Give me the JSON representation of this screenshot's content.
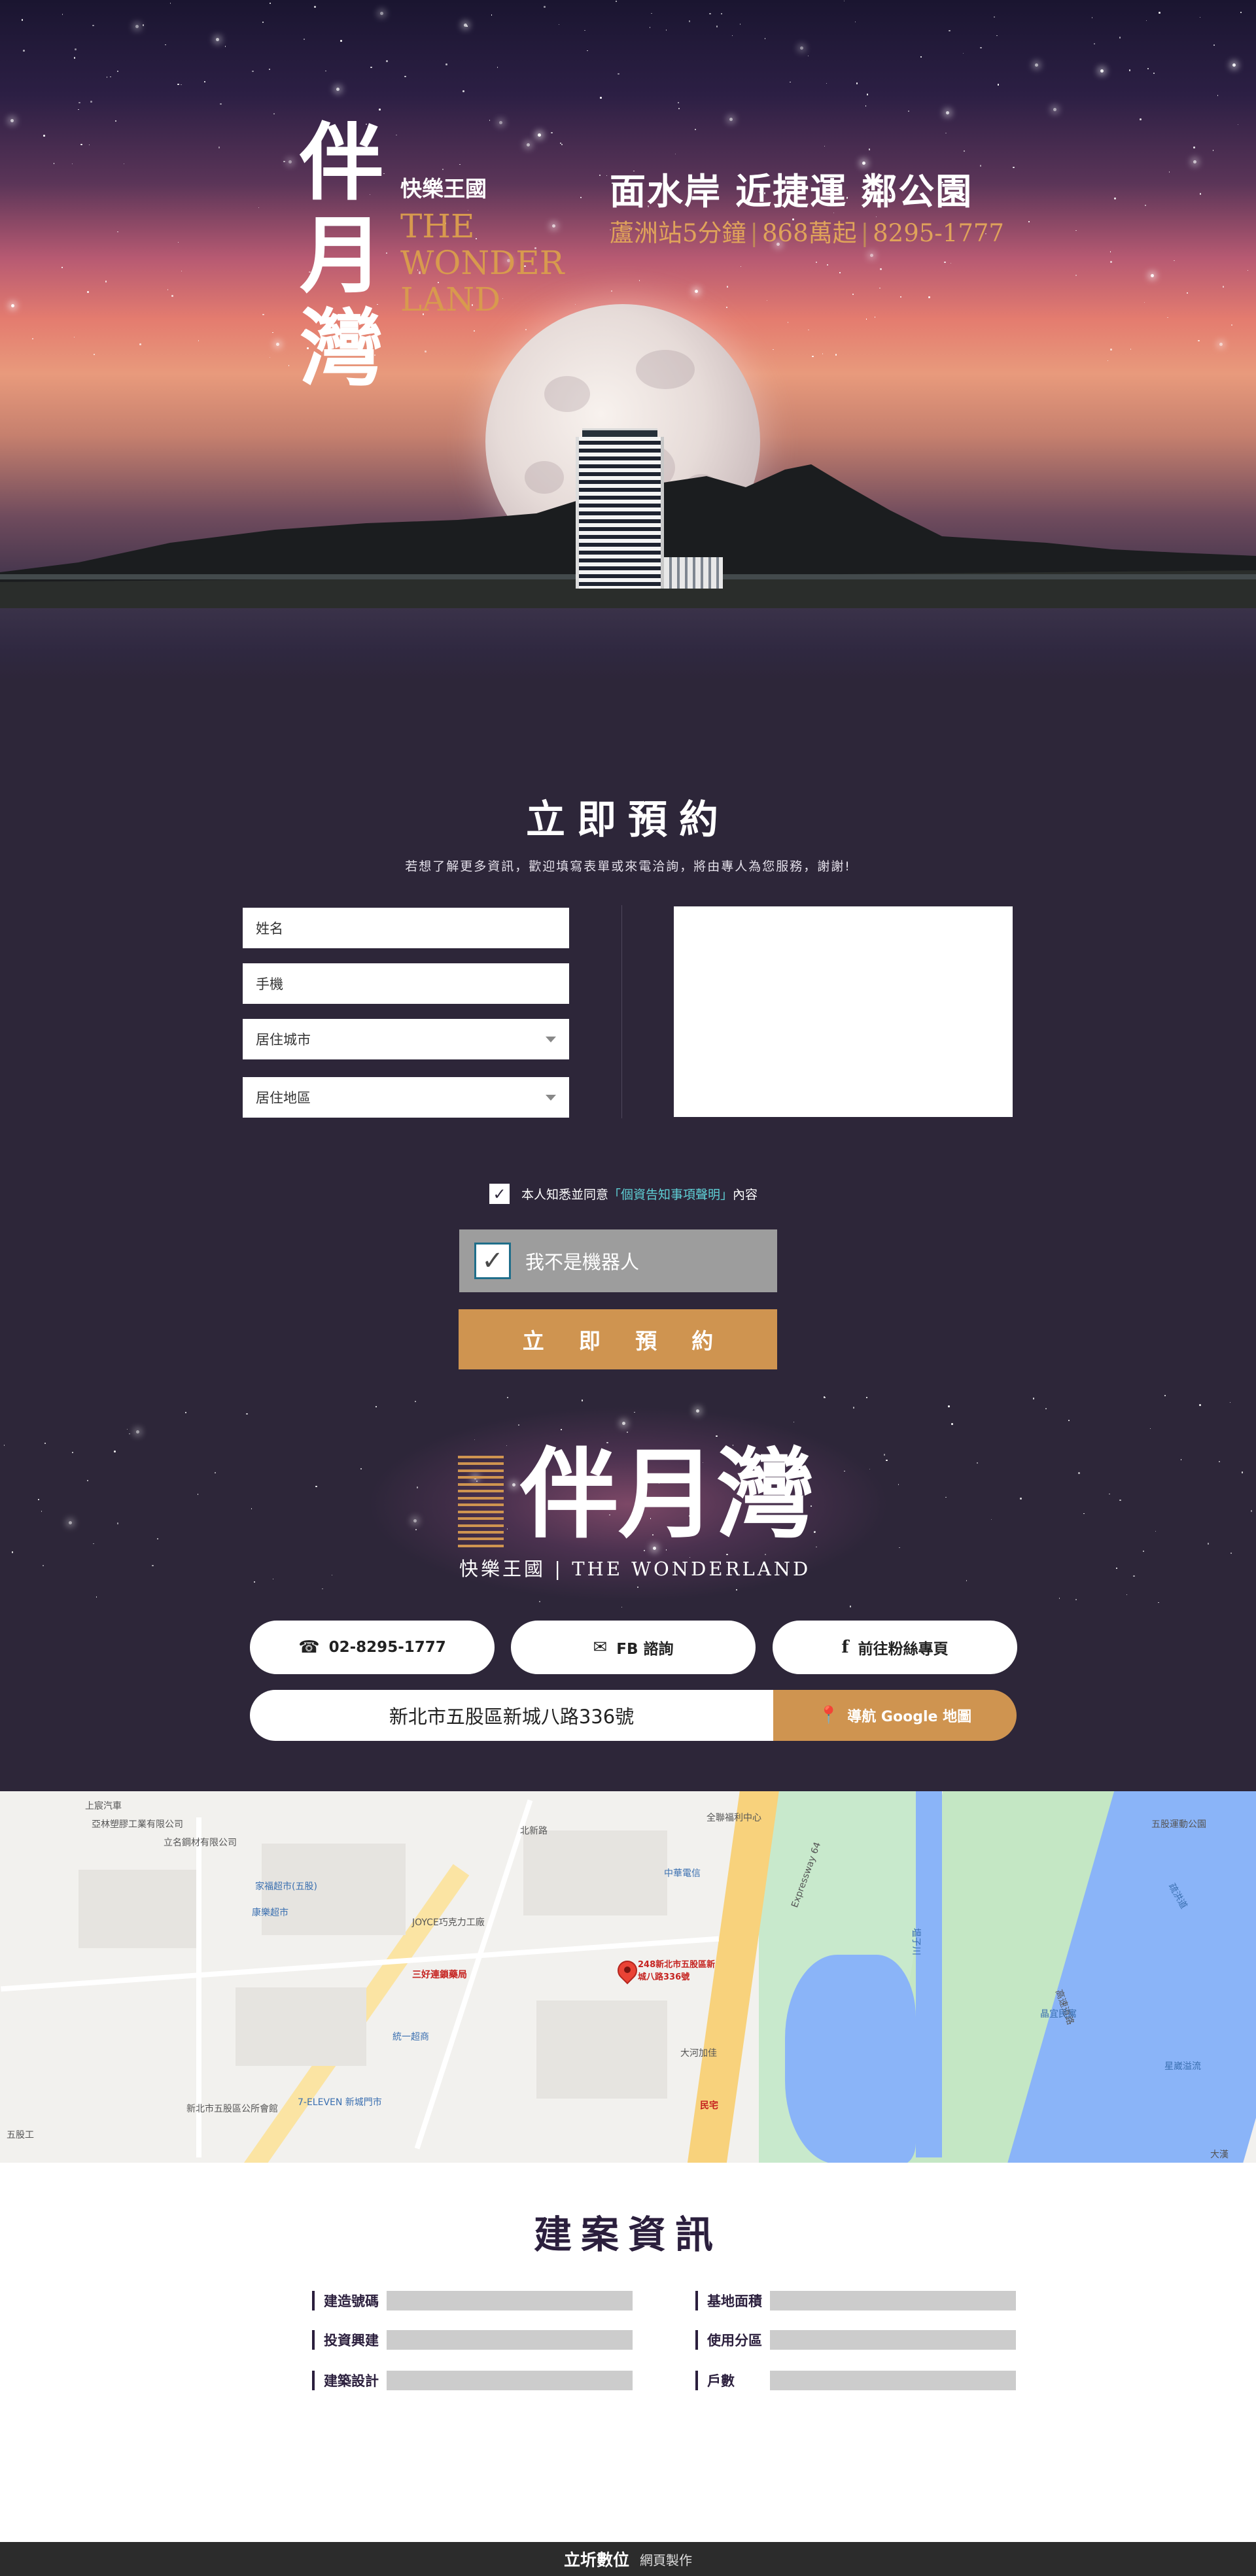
{
  "hero": {
    "logo_main": "伴月灣",
    "logo_sub_cn": "快樂王國",
    "logo_sub_en_1": "THE",
    "logo_sub_en_2": "WONDER",
    "logo_sub_en_3": "LAND",
    "slogan": "面水岸 近捷運 鄰公園",
    "detail_1": "蘆洲站5分鐘",
    "detail_2": "868萬起",
    "detail_3": "8295-1777",
    "detail_sep": "|"
  },
  "form": {
    "title": "立即預約",
    "description": "若想了解更多資訊，歡迎填寫表單或來電洽詢，將由專人為您服務，謝謝!",
    "name_placeholder": "姓名",
    "phone_placeholder": "手機",
    "city_placeholder": "居住城市",
    "district_placeholder": "居住地區",
    "agree_prefix": "本人知悉並同意",
    "agree_link": "「個資告知事項聲明」",
    "agree_suffix": "內容",
    "captcha_label": "我不是機器人",
    "submit_label": "立 即 預 約"
  },
  "contact": {
    "logo_main": "伴月灣",
    "logo_sub": "快樂王國 | THE WONDERLAND",
    "phone_label": "02-8295-1777",
    "fb_label": "FB 諮詢",
    "fans_label": "前往粉絲專頁",
    "address": "新北市五股區新城八路336號",
    "nav_label": "導航 Google 地圖"
  },
  "map": {
    "labels": [
      "上宸汽車",
      "亞林塑膠工業有限公司",
      "立名鋼材有限公司",
      "家福超市(五股)",
      "康樂超市",
      "JOYCE巧克力工廠",
      "三好連鎖藥局",
      "統一超商",
      "7-ELEVEN 新城門市",
      "新北市五股區公所會館",
      "五股工",
      "新北市五股區新城八路336號",
      "北新路",
      "大河加佳",
      "中華電信",
      "Expressway 64",
      "塭子川",
      "全聯福利中心",
      "五股運動公園",
      "疏洪道",
      "高速道路",
      "晶宜民寓",
      "星崴溢流",
      "大漢",
      "民宅"
    ],
    "pin_label": "248新北市五股區新城八路336號"
  },
  "info": {
    "title": "建案資訊",
    "rows_left": [
      "建造號碼",
      "投資興建",
      "建築設計"
    ],
    "rows_right": [
      "基地面積",
      "使用分區",
      "戶數"
    ]
  },
  "footer": {
    "brand": "立圻數位",
    "made": "網頁製作"
  },
  "colors": {
    "accent": "#cf9450",
    "background": "#2d2639",
    "link": "#5fd0d6"
  }
}
